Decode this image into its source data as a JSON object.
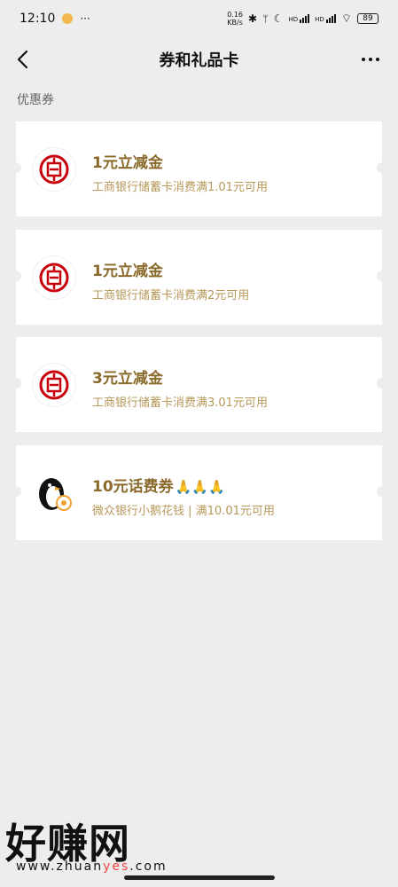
{
  "status": {
    "time": "12:10",
    "net_speed_top": "0.16",
    "net_speed_bottom": "KB/s",
    "signal1": "HD",
    "signal2": "HD",
    "battery": "89"
  },
  "nav": {
    "title": "券和礼品卡"
  },
  "section_label": "优惠券",
  "coupons": [
    {
      "logo": "icbc-logo-icon",
      "title": "1元立减金",
      "desc": "工商银行储蓄卡消费满1.01元可用"
    },
    {
      "logo": "icbc-logo-icon",
      "title": "1元立减金",
      "desc": "工商银行储蓄卡消费满2元可用"
    },
    {
      "logo": "icbc-logo-icon",
      "title": "3元立减金",
      "desc": "工商银行储蓄卡消费满3.01元可用"
    },
    {
      "logo": "webank-penguin-icon",
      "title": "10元话费券",
      "emoji": "🙏🙏🙏",
      "desc": "微众银行小鹅花钱 | 满10.01元可用"
    }
  ],
  "watermark": {
    "big": "好赚网",
    "small_pre": "www.zhuan",
    "small_hl": "yes",
    "small_post": ".com"
  },
  "colors": {
    "title": "#8a6a2a",
    "desc": "#b7985a",
    "icbc_red": "#c7000b",
    "background": "#ededed"
  }
}
